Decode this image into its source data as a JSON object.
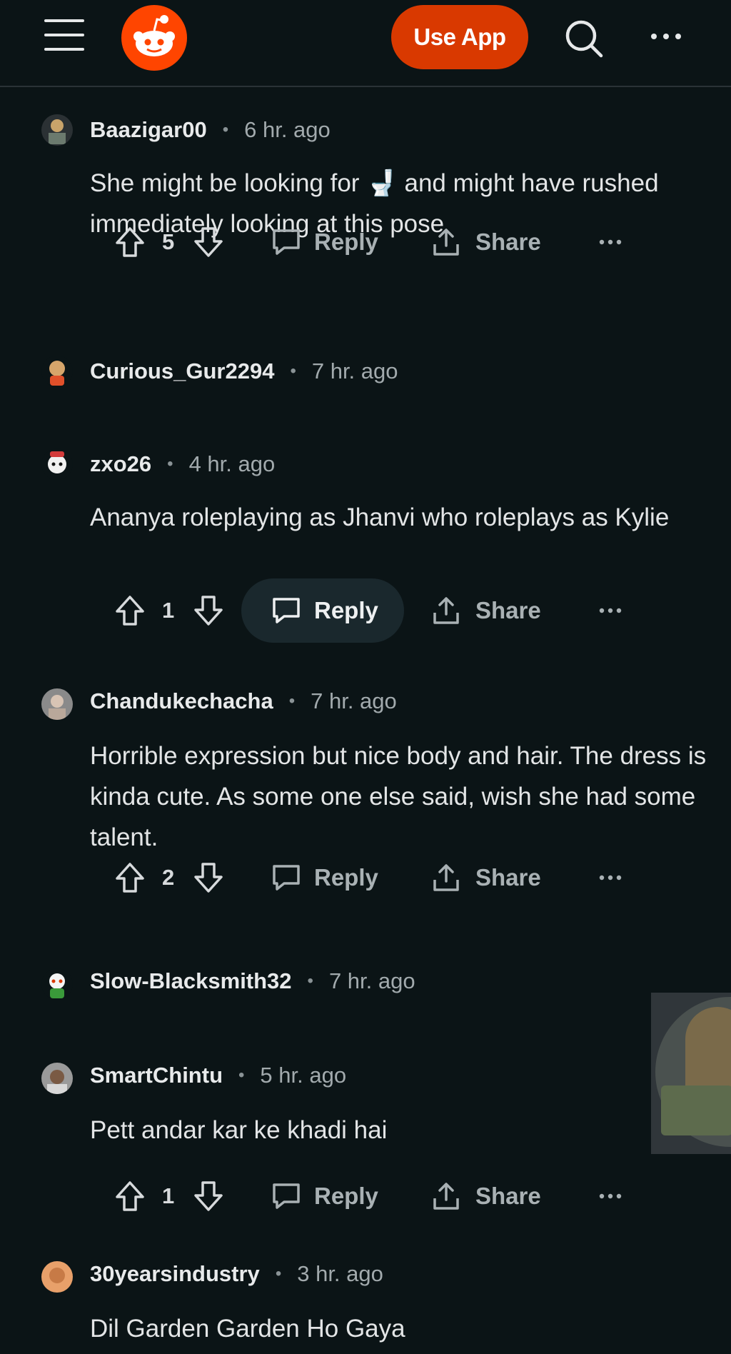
{
  "header": {
    "use_app_label": "Use App"
  },
  "comments": [
    {
      "username": "Baazigar00",
      "time": "6 hr. ago",
      "body": "She might be looking for 🚽 and might have rushed immediately looking at this pose",
      "score": "5",
      "reply_label": "Reply",
      "share_label": "Share"
    },
    {
      "username": "Curious_Gur2294",
      "time": "7 hr. ago"
    },
    {
      "username": "zxo26",
      "time": "4 hr. ago",
      "body": "Ananya roleplaying as Jhanvi who roleplays as Kylie",
      "score": "1",
      "reply_label": "Reply",
      "share_label": "Share"
    },
    {
      "username": "Chandukechacha",
      "time": "7 hr. ago",
      "body": "Horrible expression but nice body and hair. The dress is kinda cute. As some one else said, wish she had some talent.",
      "score": "2",
      "reply_label": "Reply",
      "share_label": "Share"
    },
    {
      "username": "Slow-Blacksmith32",
      "time": "7 hr. ago"
    },
    {
      "username": "SmartChintu",
      "time": "5 hr. ago",
      "body": "Pett andar kar ke khadi hai",
      "score": "1",
      "reply_label": "Reply",
      "share_label": "Share"
    },
    {
      "username": "30yearsindustry",
      "time": "3 hr. ago",
      "body": "Dil Garden Garden Ho Gaya"
    }
  ],
  "colors": {
    "background": "#0b1416",
    "accent": "#ff4500",
    "use_app_button": "#d93900"
  }
}
